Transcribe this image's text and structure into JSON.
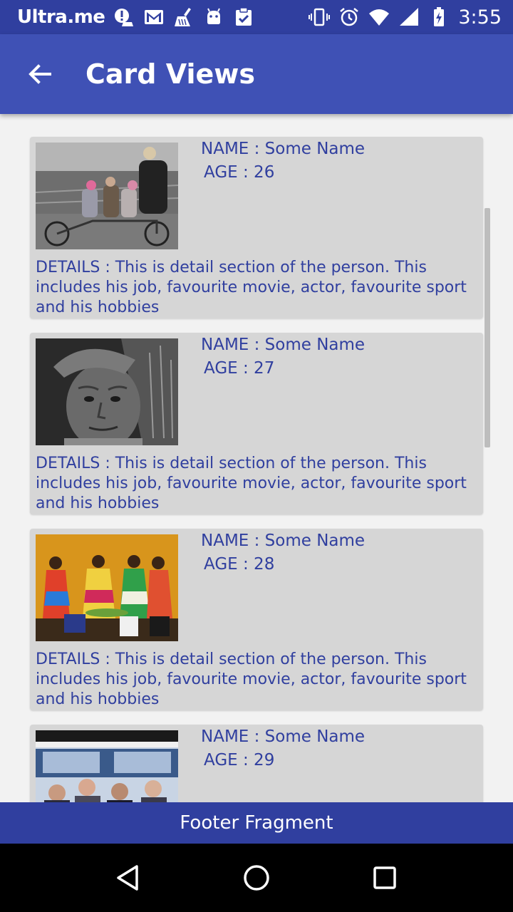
{
  "status_bar": {
    "carrier": "Ultra.me",
    "time": "3:55",
    "icons": [
      "alert-icon",
      "gmail-icon",
      "cleaner-icon",
      "android-icon",
      "clipboard-icon",
      "vibrate-icon",
      "alarm-icon",
      "wifi-icon",
      "signal-icon",
      "battery-charging-icon"
    ]
  },
  "app_bar": {
    "title": "Card Views",
    "back_icon": "arrow-back-icon"
  },
  "cards": [
    {
      "name": "NAME : Some Name",
      "age": "AGE : 26",
      "details": "DETAILS : This is detail section of the person. This includes his job, favourite movie, actor, favourite sport and his hobbies",
      "photo": "family-on-tandem-bicycle"
    },
    {
      "name": "NAME : Some Name",
      "age": "AGE : 27",
      "details": "DETAILS : This is detail section of the person. This includes his job, favourite movie, actor, favourite sport and his hobbies",
      "photo": "old-man-portrait"
    },
    {
      "name": "NAME : Some Name",
      "age": "AGE : 28",
      "details": "DETAILS : This is detail section of the person. This includes his job, favourite movie, actor, favourite sport and his hobbies",
      "photo": "women-in-colorful-dresses"
    },
    {
      "name": "NAME : Some Name",
      "age": "AGE : 29",
      "photo": "crowd-near-bus"
    }
  ],
  "footer": {
    "label": "Footer Fragment"
  },
  "nav_bar": {
    "icons": [
      "back-triangle-icon",
      "home-circle-icon",
      "recents-square-icon"
    ]
  },
  "colors": {
    "primary": "#3f51b5",
    "primary_dark": "#303f9f",
    "card_bg": "#d6d6d6",
    "text": "#303f9f"
  }
}
